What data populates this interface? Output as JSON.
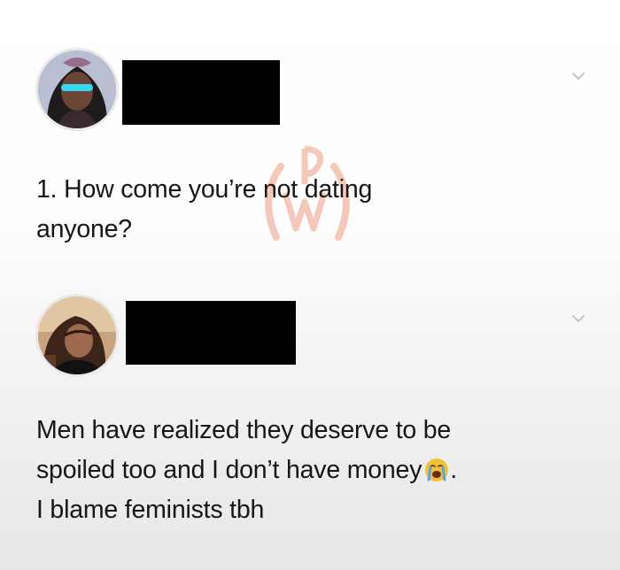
{
  "tweets": [
    {
      "author_name": "",
      "author_redacted": true,
      "text_lines": [
        "1. How come you’re not dating",
        "anyone?"
      ],
      "menu_icon": "chevron-down-icon",
      "avatar_icon": "profile-photo"
    },
    {
      "author_name": "",
      "author_redacted": true,
      "text_lines": [
        "Men have realized they deserve to be",
        "spoiled too and I don’t have money",
        "I blame feminists tbh"
      ],
      "line_suffix_emoji": "loudly-crying-face-icon",
      "line_suffix_text": ".",
      "menu_icon": "chevron-down-icon",
      "avatar_icon": "profile-photo"
    }
  ],
  "watermark": {
    "text": "WP",
    "color": "#e8663a"
  },
  "colors": {
    "redaction": "#000000",
    "text": "#161616",
    "chevron": "#bdbdbd"
  }
}
